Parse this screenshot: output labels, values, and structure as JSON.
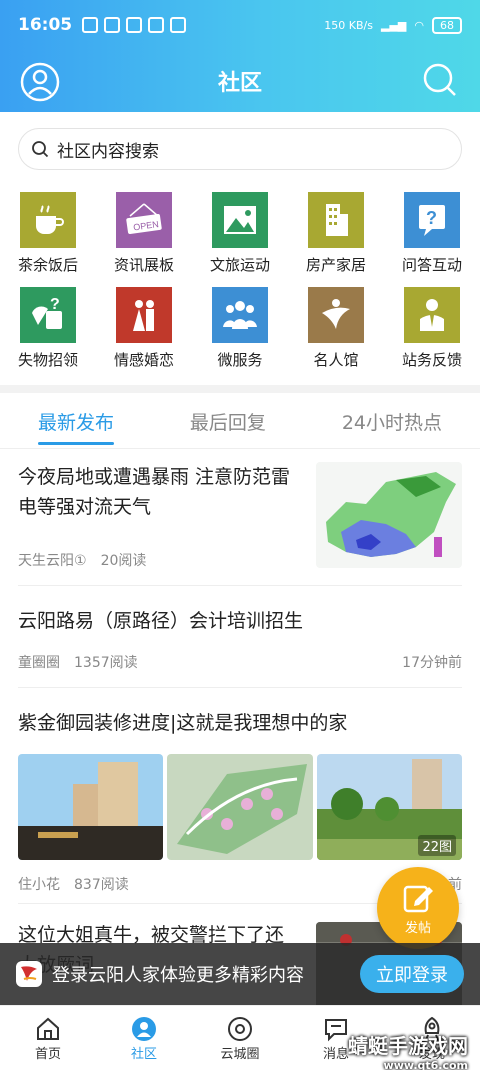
{
  "status": {
    "time": "16:05",
    "speed": "150 KB/s",
    "battery": "68"
  },
  "header": {
    "title": "社区"
  },
  "search": {
    "placeholder": "社区内容搜索"
  },
  "grid": [
    {
      "label": "茶余饭后",
      "icon": "tea-cup-icon",
      "color": "#a8a832"
    },
    {
      "label": "资讯展板",
      "icon": "open-sign-icon",
      "color": "#9a5fa9"
    },
    {
      "label": "文旅运动",
      "icon": "landscape-icon",
      "color": "#2e9a5f"
    },
    {
      "label": "房产家居",
      "icon": "building-icon",
      "color": "#a8a832"
    },
    {
      "label": "问答互动",
      "icon": "question-icon",
      "color": "#3d8fd4"
    },
    {
      "label": "失物招领",
      "icon": "umbrella-question-icon",
      "color": "#2e9a5f"
    },
    {
      "label": "情感婚恋",
      "icon": "couple-icon",
      "color": "#c0392b"
    },
    {
      "label": "微服务",
      "icon": "group-icon",
      "color": "#3d8fd4"
    },
    {
      "label": "名人馆",
      "icon": "celebrity-icon",
      "color": "#9a7a4a"
    },
    {
      "label": "站务反馈",
      "icon": "staff-icon",
      "color": "#a8a832"
    }
  ],
  "tabs": [
    {
      "label": "最新发布",
      "active": true
    },
    {
      "label": "最后回复",
      "active": false
    },
    {
      "label": "24小时热点",
      "active": false
    }
  ],
  "posts": [
    {
      "title": "今夜局地或遭遇暴雨 注意防范雷电等强对流天气",
      "author": "天生云阳①",
      "reads": "20阅读",
      "time": ""
    },
    {
      "title": "云阳路易（原路径）会计培训招生",
      "author": "童圈圈",
      "reads": "1357阅读",
      "time": "17分钟前"
    },
    {
      "title": "紫金御园装修进度|这就是我理想中的家",
      "author": "住小花",
      "reads": "837阅读",
      "time": "17分钟前",
      "image_count": "22图"
    },
    {
      "title": "这位大姐真牛，被交警拦下了还大放厥词",
      "author": "",
      "reads": "",
      "time": ""
    }
  ],
  "banner": {
    "text": "登录云阳人家体验更多精彩内容",
    "button": "立即登录"
  },
  "fab": {
    "label": "发帖"
  },
  "nav": [
    {
      "label": "首页",
      "icon": "home-icon",
      "active": false
    },
    {
      "label": "社区",
      "icon": "community-icon",
      "active": true
    },
    {
      "label": "云城圈",
      "icon": "circle-icon",
      "active": false
    },
    {
      "label": "消息",
      "icon": "message-icon",
      "active": false
    },
    {
      "label": "发现",
      "icon": "rocket-icon",
      "active": false
    }
  ],
  "watermark": {
    "text": "蜻蜓手游戏网",
    "url": "www.qt6.com"
  },
  "colors": {
    "accent": "#2a9be6",
    "fab": "#f6b21a"
  }
}
